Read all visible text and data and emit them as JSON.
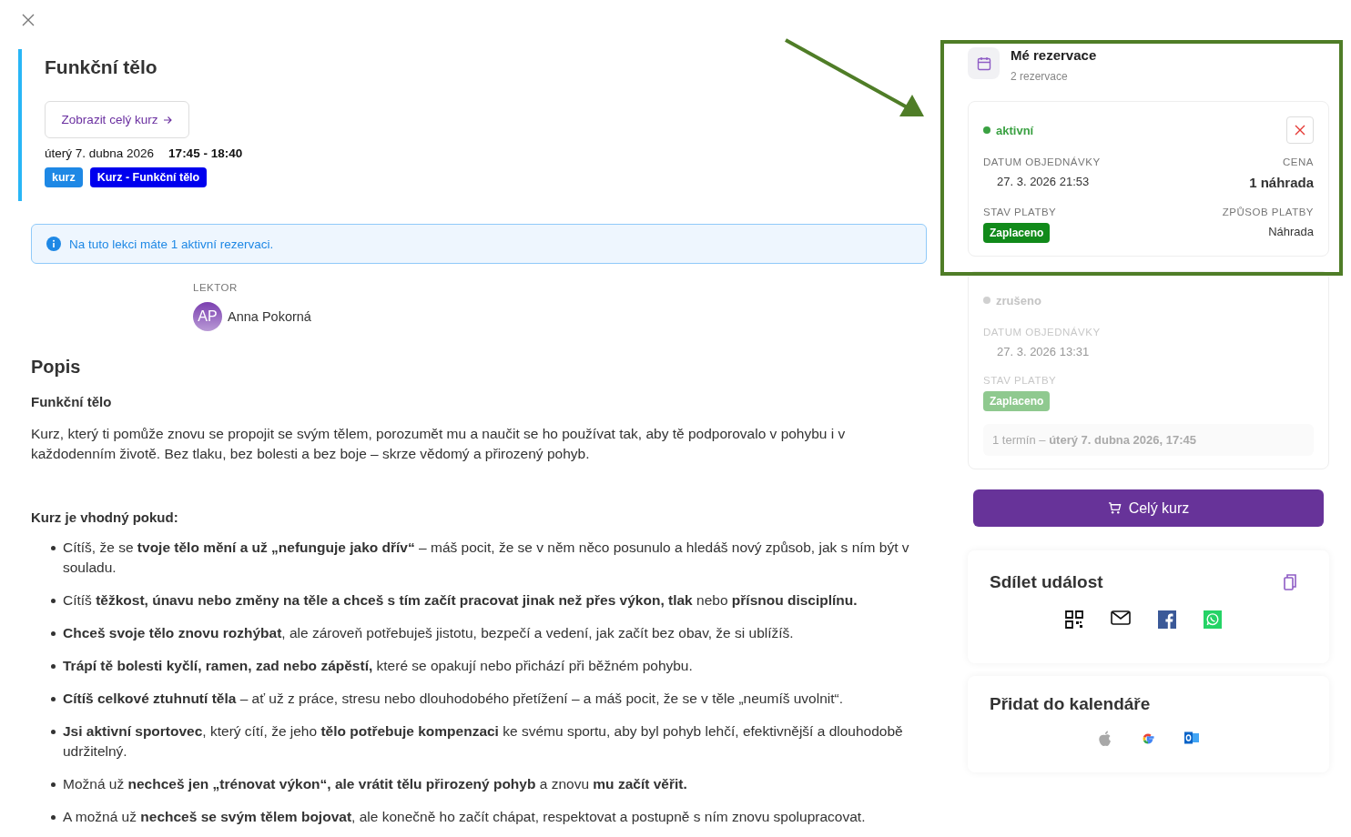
{
  "event": {
    "title": "Funkční tělo",
    "course_link": "Zobrazit celý kurz",
    "date": "úterý 7. dubna 2026",
    "time": "17:45 - 18:40",
    "tags": [
      {
        "label": "kurz",
        "color": "#1e88e5"
      },
      {
        "label": "Kurz - Funkční tělo",
        "color": "#0000ee"
      }
    ]
  },
  "notice": "Na tuto lekci máte 1 aktivní rezervaci.",
  "lecturer": {
    "label": "LEKTOR",
    "initials": "AP",
    "name": "Anna Pokorná"
  },
  "description": {
    "heading": "Popis",
    "subheading": "Funkční tělo",
    "paragraph": "Kurz, který ti pomůže znovu se propojit se svým tělem, porozumět mu a naučit se ho používat tak, aby tě podporovalo v pohybu i v každodenním životě. Bez tlaku, bez bolesti a bez boje – skrze vědomý a přirozený pohyb.",
    "list_heading": "Kurz je vhodný pokud:",
    "bullets": [
      "Cítíš, že se **tvoje tělo mění a už „nefunguje jako dřív“** – máš pocit, že se v něm něco posunulo a hledáš nový způsob, jak s ním být v souladu.",
      "Cítíš **těžkost, únavu nebo změny na těle a chceš s tím začít pracovat jinak než přes výkon, tlak** nebo **přísnou disciplínu.**",
      "**Chceš svoje tělo znovu rozhýbat**, ale zároveň potřebuješ jistotu, bezpečí a vedení, jak začít bez obav, že si ublížíš.",
      "**Trápí tě bolesti kyčlí, ramen, zad nebo zápěstí,** které se opakují nebo přichází při běžném pohybu.",
      "**Cítíš celkové ztuhnutí těla** – ať už z práce, stresu nebo dlouhodobého přetížení – a máš pocit, že se v těle „neumíš uvolnit“.",
      "**Jsi aktivní sportovec**, který cítí, že jeho **tělo potřebuje kompenzaci** ke svému sportu, aby byl pohyb lehčí, efektivnější a dlouhodobě udržitelný.",
      "Možná už **nechceš jen „trénovat výkon“, ale vrátit tělu přirozený pohyb** a znovu **mu začít věřit.**",
      "A možná už **nechceš se svým tělem bojovat**, ale konečně ho začít chápat, respektovat a postupně s ním znovu spolupracovat."
    ]
  },
  "reservations": {
    "title": "Mé rezervace",
    "count": "2 rezervace",
    "highlighted": true,
    "items": [
      {
        "status": "aktivní",
        "active": true,
        "cancelable": true,
        "order_date_label": "DATUM OBJEDNÁVKY",
        "order_date": "27. 3. 2026 21:53",
        "price_label": "CENA",
        "price": "1 náhrada",
        "payment_status_label": "STAV PLATBY",
        "payment_status": "Zaplaceno",
        "payment_method_label": "ZPŮSOB PLATBY",
        "payment_method": "Náhrada"
      },
      {
        "status": "zrušeno",
        "active": false,
        "cancelable": false,
        "order_date_label": "DATUM OBJEDNÁVKY",
        "order_date": "27. 3. 2026 13:31",
        "payment_status_label": "STAV PLATBY",
        "payment_status": "Zaplaceno",
        "term": "1 termín – **úterý 7. dubna 2026, 17:45**"
      }
    ]
  },
  "buy_button": "Celý kurz",
  "share": {
    "title": "Sdílet událost"
  },
  "calendar": {
    "title": "Přidat do kalendáře"
  }
}
